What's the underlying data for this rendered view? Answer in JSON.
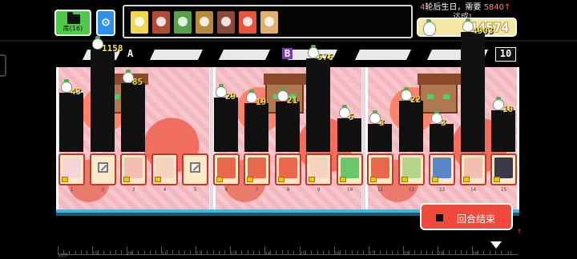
{
  "top_bar": {
    "deck_label": "库(16)",
    "inventory": [
      {
        "icon": "pineapple-face-item",
        "color": "#f2d64b"
      },
      {
        "icon": "berry-bush-item",
        "color": "#b34a35"
      },
      {
        "icon": "green-frog-item",
        "color": "#5aa04a"
      },
      {
        "icon": "tree-item",
        "color": "#b98a3a"
      },
      {
        "icon": "mushroom-item",
        "color": "#8a4a3a"
      },
      {
        "icon": "fire-item",
        "color": "#e8553d"
      },
      {
        "icon": "bunny-item",
        "color": "#e0b070"
      }
    ]
  },
  "birthday": {
    "count": "4",
    "text": "轮后生日，需要",
    "needed": "5840",
    "arrow": "↑",
    "status": "达成!"
  },
  "score": {
    "value": "14574"
  },
  "sections": {
    "a": "A",
    "b": "B",
    "round": "10"
  },
  "columns": [
    {
      "value": "43",
      "height": 43,
      "idx": "1"
    },
    {
      "value": "1158",
      "height": 1158,
      "idx": "2"
    },
    {
      "value": "85",
      "height": 85,
      "idx": "3"
    },
    {
      "value": "",
      "height": 0,
      "idx": "4"
    },
    {
      "value": "",
      "height": 0,
      "idx": "5"
    },
    {
      "value": "29",
      "height": 29,
      "idx": "6"
    },
    {
      "value": "19",
      "height": 19,
      "idx": "7"
    },
    {
      "value": "21",
      "height": 21,
      "idx": "8"
    },
    {
      "value": "576",
      "height": 576,
      "idx": "9"
    },
    {
      "value": "5",
      "height": 5,
      "idx": "10"
    },
    {
      "value": "3",
      "height": 3,
      "idx": "11"
    },
    {
      "value": "22",
      "height": 22,
      "idx": "12"
    },
    {
      "value": "3",
      "height": 3,
      "idx": "13"
    },
    {
      "value": "4903",
      "height": 4903,
      "idx": "14"
    },
    {
      "value": "10",
      "height": 10,
      "idx": "15"
    }
  ],
  "cards": [
    {
      "kind": "bunny",
      "color": "#f5d5d5"
    },
    {
      "kind": "empty",
      "color": ""
    },
    {
      "kind": "bunny-fox",
      "color": "#f3c0b0"
    },
    {
      "kind": "worm",
      "color": "#f6d2c0"
    },
    {
      "kind": "empty",
      "color": ""
    },
    {
      "kind": "fire-fox",
      "color": "#e9674a"
    },
    {
      "kind": "fire-fox",
      "color": "#e9674a"
    },
    {
      "kind": "fire-fox",
      "color": "#e9674a"
    },
    {
      "kind": "worm",
      "color": "#f6d2c0"
    },
    {
      "kind": "green-ring",
      "color": "#6ac66a"
    },
    {
      "kind": "fire-fox",
      "color": "#e9674a"
    },
    {
      "kind": "bow",
      "color": "#b5d48a"
    },
    {
      "kind": "blue-hood",
      "color": "#5c86c8"
    },
    {
      "kind": "bunny-fox",
      "color": "#f3c0b0"
    },
    {
      "kind": "dark-dragon",
      "color": "#3a3a48"
    }
  ],
  "end_button": {
    "label": "回合结束"
  },
  "timeline": {
    "ticks": [
      "18岁",
      "19",
      "20",
      "21",
      "22",
      "23",
      "24",
      "25",
      "26",
      "27",
      "28",
      "29",
      "30",
      "31"
    ]
  }
}
